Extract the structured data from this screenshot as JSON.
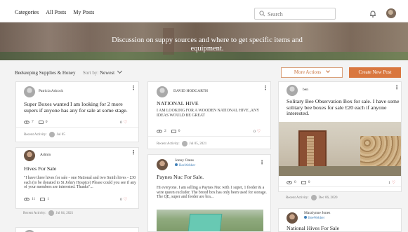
{
  "nav": {
    "categories": "Categories",
    "all_posts": "All Posts",
    "my_posts": "My Posts"
  },
  "search": {
    "placeholder": "Search"
  },
  "banner": {
    "line1": "Discussion on suppy sources and where to get specific items and",
    "line2": "equipment."
  },
  "toolbar": {
    "breadcrumb": "Beekeeping Supplies & Honey",
    "sort_label": "Sort by:",
    "sort_value": "Newest",
    "more_actions": "More Actions",
    "create_post": "Create New Post"
  },
  "posts": [
    {
      "author": "Patricia Adcock",
      "title": "Super Boxes wanted I am looking for 2 more supers if anyone has any for sale at some stage.",
      "views": "7",
      "comments": "0",
      "likes": "0",
      "activity_label": "Recent Activity:",
      "activity_date": "Jul 05"
    },
    {
      "author": "DAVID HODGARTH",
      "title": "NATIONAL HIVE",
      "excerpt": "I AM LOOKING FOR A WOODEN NATIONAL HIVE ,ANY IDEAS WOULD BE GREAT",
      "views": "2",
      "comments": "0",
      "likes": "0",
      "activity_label": "Recent Activity:",
      "activity_date": "Jul 05, 2021"
    },
    {
      "author": "ben",
      "title": "Solitary Bee Observation Box for sale. I have some solitary bee boxes for sale £20 each if anyone interested.",
      "views": "0",
      "comments": "0",
      "likes": "1",
      "activity_label": "Recent Activity:",
      "activity_date": "Dec 06, 2020"
    },
    {
      "author": "Admin",
      "title": "Hives For Sale",
      "excerpt": "\"I have three hives for sale - one National and two Smith hives - £30 each (to be donated to St John's Hospice) Please could you see if any of your members are interested. Thanks\"...",
      "views": "11",
      "comments": "1",
      "likes": "0",
      "activity_label": "Recent Activity:",
      "activity_date": "Jul 04, 2021"
    },
    {
      "author": "Jonny Oates",
      "badge": "BeeWebber",
      "title": "Paynes Nuc For Sale.",
      "excerpt": "Hi everyone. I am selling a Paynes Nuc with 1 super, 1 feeder & a wire queen excluder. The brood box has only been used for storage. The QE, super and feeder are bra..."
    },
    {
      "author": "Maralynne Jones",
      "badge": "BeeWebber",
      "title": "National Hives For Sale"
    }
  ]
}
